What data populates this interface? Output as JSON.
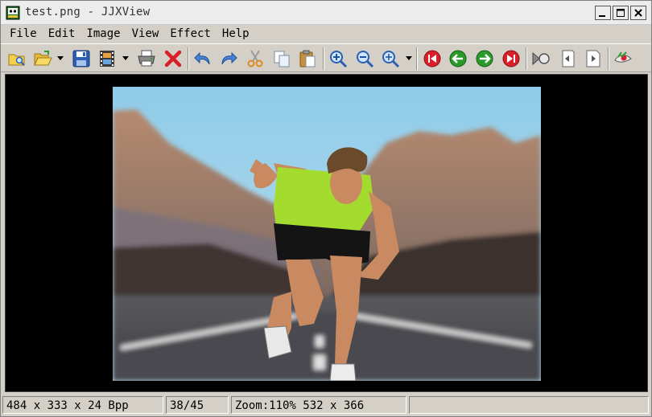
{
  "window": {
    "title": "test.png - JJXView"
  },
  "menu": [
    {
      "key": "file",
      "label": "File"
    },
    {
      "key": "edit",
      "label": "Edit"
    },
    {
      "key": "image",
      "label": "Image"
    },
    {
      "key": "view",
      "label": "View"
    },
    {
      "key": "effect",
      "label": "Effect"
    },
    {
      "key": "help",
      "label": "Help"
    }
  ],
  "toolbar_icons": [
    "browse-folder-icon",
    "open-folder-icon",
    "save-icon",
    "filmstrip-icon",
    "print-icon",
    "delete-icon",
    "undo-icon",
    "redo-icon",
    "cut-icon",
    "copy-icon",
    "paste-icon",
    "zoom-in-icon",
    "zoom-out-icon",
    "zoom-icon",
    "first-image-icon",
    "previous-image-icon",
    "next-image-icon",
    "last-image-icon",
    "slideshow-icon",
    "rotate-left-icon",
    "rotate-right-icon",
    "effect-icon"
  ],
  "status": {
    "image_info": "484 x 333 x 24 Bpp",
    "position": "38/45",
    "zoom": "Zoom:110% 532 x 366",
    "extra": ""
  },
  "colors": {
    "face": "#d4d0c8",
    "canvas_bg": "#000000",
    "nav_red": "#d8202a",
    "nav_green": "#2a9a2a",
    "icon_blue": "#2b5fb3"
  }
}
